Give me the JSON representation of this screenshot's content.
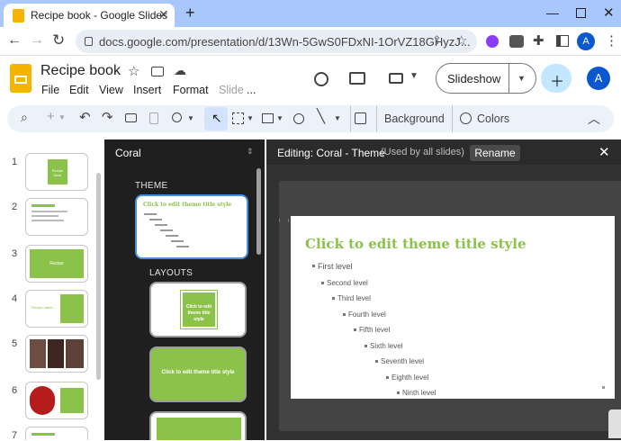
{
  "browser": {
    "tab_title": "Recipe book - Google Slides",
    "url": "docs.google.com/presentation/d/13Wn-5GwS0FDxNI-1OrVZ18GHyzJ...",
    "profile_initial": "A"
  },
  "app": {
    "doc_title": "Recipe book",
    "menu": [
      "File",
      "Edit",
      "View",
      "Insert",
      "Format",
      "Slide",
      "..."
    ],
    "slideshow_label": "Slideshow",
    "avatar_initial": "A"
  },
  "toolbar": {
    "background_label": "Background",
    "colors_label": "Colors"
  },
  "filmstrip": {
    "slides": [
      {
        "number": "1",
        "text": "Recipe book"
      },
      {
        "number": "2",
        "text": ""
      },
      {
        "number": "3",
        "text": "Recipe"
      },
      {
        "number": "4",
        "text": "Recipe name"
      },
      {
        "number": "5",
        "text": ""
      },
      {
        "number": "6",
        "text": ""
      },
      {
        "number": "7",
        "text": ""
      }
    ]
  },
  "theme_panel": {
    "theme_name": "Coral",
    "theme_section": "THEME",
    "layouts_section": "LAYOUTS",
    "thumb_title": "Click to edit theme title style"
  },
  "editor": {
    "editing_label": "Editing: Coral - Theme",
    "used_label": "(Used by all slides)",
    "rename_label": "Rename",
    "slide": {
      "title": "Click to edit theme title style",
      "levels": [
        "First level",
        "Second level",
        "Third level",
        "Fourth level",
        "Fifth level",
        "Sixth level",
        "Seventh level",
        "Eighth level",
        "Ninth level"
      ]
    }
  },
  "colors": {
    "accent_green": "#8bc34a",
    "selection_blue": "#4a90e2",
    "panel_dark": "#1f1f1f"
  }
}
